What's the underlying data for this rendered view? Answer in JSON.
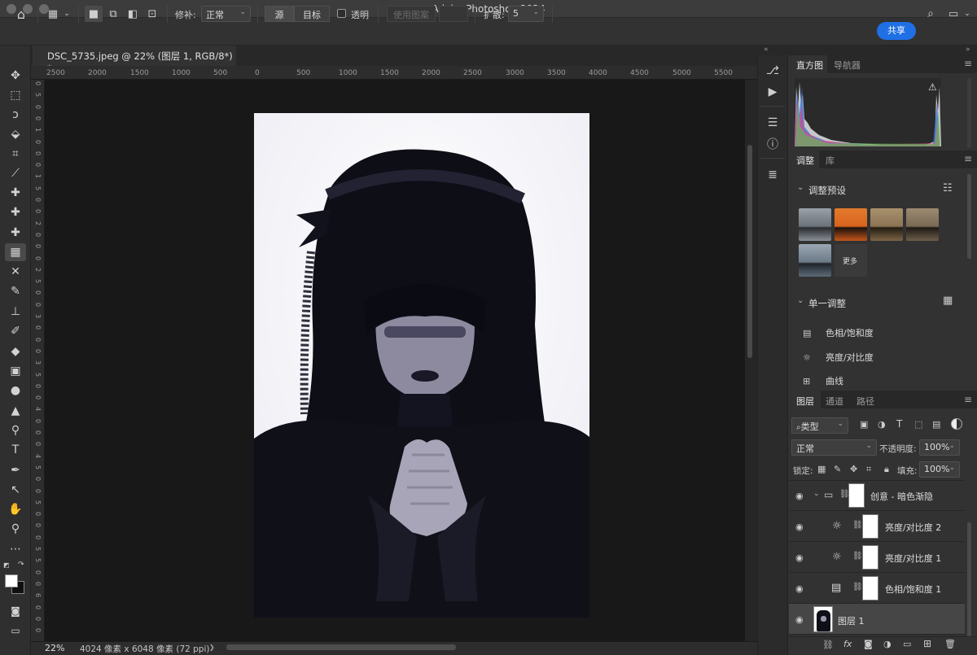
{
  "window": {
    "title": "Adobe Photoshop 2024"
  },
  "options_bar": {
    "patch_label": "修补:",
    "patch_mode": "正常",
    "source_btn": "源",
    "target_btn": "目标",
    "transparent_label": "透明",
    "use_pattern_btn": "使用图案",
    "diffusion_label": "扩散:",
    "diffusion_value": "5",
    "share_btn": "共享"
  },
  "document_tab": {
    "title": "DSC_5735.jpeg @ 22% (图层 1, RGB/8*) *"
  },
  "ruler": {
    "h_labels": [
      "2500",
      "2000",
      "1500",
      "1000",
      "500",
      "0",
      "500",
      "1000",
      "1500",
      "2000",
      "2500",
      "3000",
      "3500",
      "4000",
      "4500",
      "5000",
      "5500"
    ],
    "v_labels": [
      "0",
      "5",
      "0",
      "0",
      "1",
      "0",
      "0",
      "0",
      "1",
      "5",
      "0",
      "0",
      "2",
      "0",
      "0",
      "0",
      "2",
      "5",
      "0",
      "0",
      "3",
      "0",
      "0",
      "0",
      "3",
      "5",
      "0",
      "0",
      "4",
      "0",
      "0",
      "0",
      "4",
      "5",
      "0",
      "0",
      "5",
      "0",
      "0",
      "0",
      "5",
      "5",
      "0",
      "0",
      "6",
      "0",
      "0",
      "0"
    ]
  },
  "status_bar": {
    "zoom": "22%",
    "doc_info": "4024 像素 x 6048 像素 (72 ppi)",
    "arrow": "❯"
  },
  "histogram_panel": {
    "tabs": [
      "直方图",
      "导航器"
    ],
    "warning": "⚠"
  },
  "adjustments_panel": {
    "tabs": [
      "调整",
      "库"
    ],
    "presets_title": "调整预设",
    "more_label": "更多",
    "single_title": "单一调整",
    "items": [
      "色相/饱和度",
      "亮度/对比度",
      "曲线"
    ],
    "preset_colors": [
      "#8a9097",
      "#d9641d",
      "#8c7355",
      "#7a6a55",
      "#6d7b8a"
    ]
  },
  "layers_panel": {
    "tabs": [
      "图层",
      "通道",
      "路径"
    ],
    "filter_kind": "类型",
    "blend_mode": "正常",
    "opacity_label": "不透明度:",
    "opacity_value": "100%",
    "lock_label": "锁定:",
    "fill_label": "填充:",
    "fill_value": "100%",
    "layers": [
      {
        "name": "创意 - 暗色渐隐",
        "kind": "group"
      },
      {
        "name": "亮度/对比度 2",
        "kind": "brightness"
      },
      {
        "name": "亮度/对比度 1",
        "kind": "brightness"
      },
      {
        "name": "色相/饱和度 1",
        "kind": "huesat"
      },
      {
        "name": "图层 1",
        "kind": "pixel"
      }
    ]
  },
  "colors": {
    "accent": "#1f6fe5",
    "panel": "#323232",
    "canvas": "#181818"
  }
}
